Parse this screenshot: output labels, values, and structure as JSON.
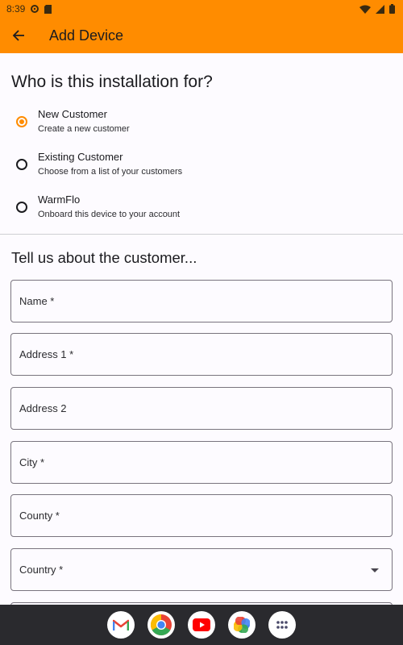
{
  "status": {
    "time": "8:39"
  },
  "appbar": {
    "title": "Add Device"
  },
  "question": "Who is this installation for?",
  "options": [
    {
      "label": "New Customer",
      "sub": "Create a new customer",
      "selected": true
    },
    {
      "label": "Existing Customer",
      "sub": "Choose from a list of your customers",
      "selected": false
    },
    {
      "label": "WarmFlo",
      "sub": "Onboard this device to your account",
      "selected": false
    }
  ],
  "section_title": "Tell us about the customer...",
  "fields": {
    "name": "Name *",
    "address1": "Address 1 *",
    "address2": "Address 2",
    "city": "City *",
    "county": "County *",
    "country": "Country *"
  },
  "colors": {
    "accent": "#ff8c00",
    "dock": "#2a2a2e"
  },
  "dock_apps": [
    "gmail-icon",
    "chrome-icon",
    "youtube-icon",
    "photos-icon",
    "app-drawer-icon"
  ]
}
